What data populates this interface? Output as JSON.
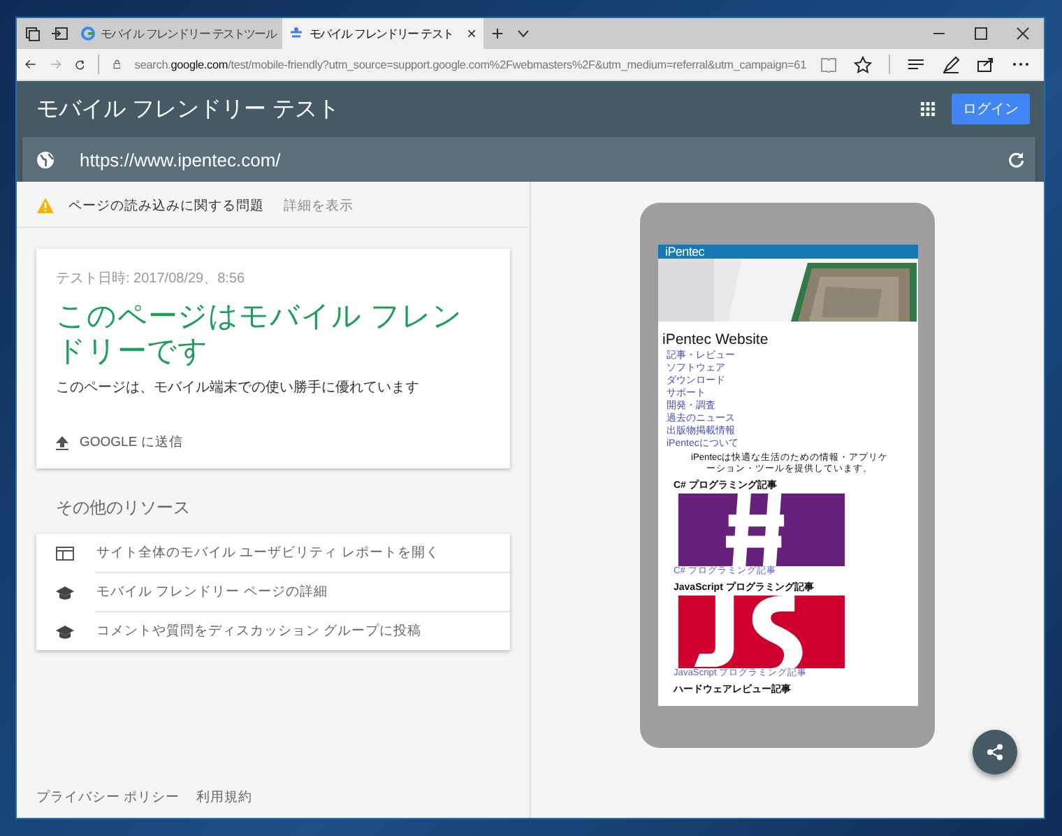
{
  "browser": {
    "tabs": [
      {
        "title": "モバイル フレンドリー テストツール",
        "selected": false
      },
      {
        "title": "モバイル フレンドリー テスト",
        "selected": true,
        "close": "×"
      }
    ],
    "new_tab": "+",
    "address": "search.**google.com**/test/mobile-friendly?utm_source=support.google.com%2Fwebmasters%2F&utm_medium=referral&utm_campaign=61"
  },
  "header": {
    "title": "モバイル フレンドリー テスト",
    "login_button": "ログイン"
  },
  "url_field": {
    "value": "https://www.ipentec.com/"
  },
  "warning": {
    "text": "ページの読み込みに関する問題",
    "link": "詳細を表示"
  },
  "result": {
    "timestamp": "テスト日時: 2017/08/29、8:56",
    "headline": "このページはモバイル フレンドリーです",
    "description": "このページは、モバイル端末での使い勝手に優れています",
    "submit": "GOOGLE に送信"
  },
  "resources": {
    "title": "その他のリソース",
    "items": [
      {
        "kind": "report",
        "label": "サイト全体のモバイル ユーザビリティ レポートを開く"
      },
      {
        "kind": "learn",
        "label": "モバイル フレンドリー ページの詳細"
      },
      {
        "kind": "learn",
        "label": "コメントや質問をディスカッション グループに投稿"
      }
    ]
  },
  "footer": {
    "links": [
      "プライバシー ポリシー",
      "利用規約"
    ]
  },
  "preview": {
    "site_bar": "iPentec",
    "site_title": "iPentec Website",
    "nav": [
      "記事・レビュー",
      "ソフトウェア",
      "ダウンロード",
      "サポート",
      "開発・調査",
      "過去のニュース",
      "出版物掲載情報",
      "iPentecについて"
    ],
    "intro": "iPentecは快適な生活のための情報・アプリケーション・ツールを提供しています。",
    "sections": [
      {
        "heading": "C# プログラミング記事",
        "kind": "csharp",
        "link": "C# プログラミング記事"
      },
      {
        "heading": "JavaScript プログラミング記事",
        "kind": "js",
        "link": "JavaScript プログラミング記事"
      }
    ],
    "cut_heading": "ハードウェアレビュー記事"
  }
}
